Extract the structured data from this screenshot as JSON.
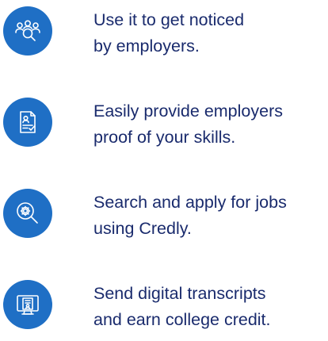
{
  "colors": {
    "icon_circle": "#1f6fc5",
    "icon_stroke": "#ffffff",
    "text": "#1a2b6d"
  },
  "items": [
    {
      "icon": "people-search-icon",
      "line1": "Use it to get noticed",
      "line2": "by employers."
    },
    {
      "icon": "document-check-icon",
      "line1": "Easily provide employers",
      "line2": "proof of your skills."
    },
    {
      "icon": "gear-search-icon",
      "line1": "Search and apply for jobs",
      "line2": "using Credly."
    },
    {
      "icon": "monitor-transcript-icon",
      "line1": "Send digital transcripts",
      "line2": "and earn college credit."
    }
  ]
}
